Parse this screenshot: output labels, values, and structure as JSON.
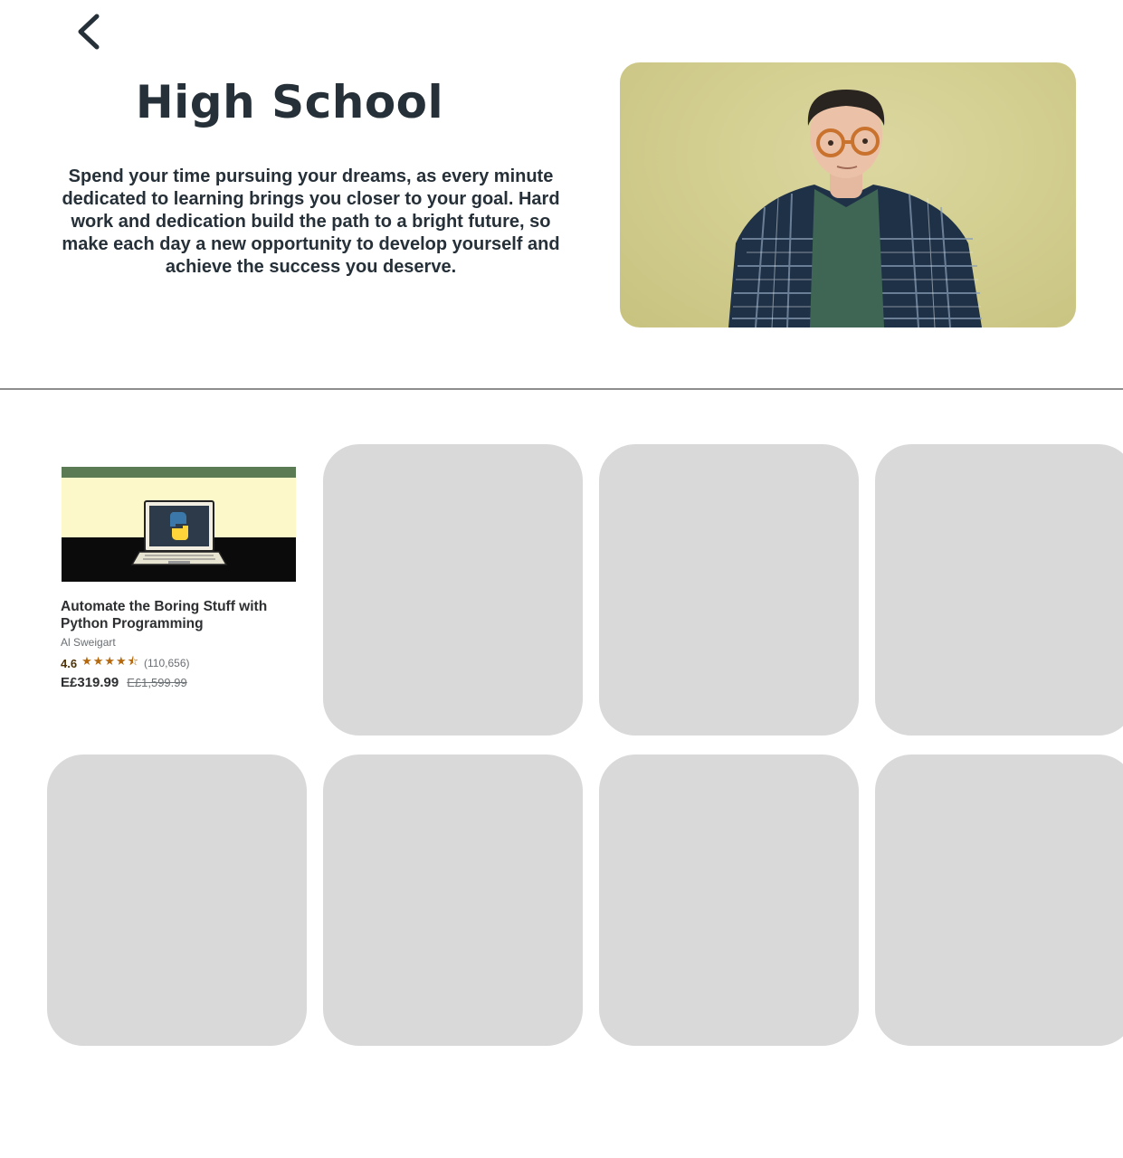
{
  "header": {
    "title": "High School",
    "description": "Spend your time pursuing your dreams, as every minute dedicated to learning brings you closer to your goal. Hard work and dedication build the path to a bright future, so make each day a new opportunity to develop yourself and achieve the success you deserve."
  },
  "icons": {
    "back": "chevron-left-icon",
    "python_logo": "python-logo-icon"
  },
  "colors": {
    "text": "#263038",
    "placeholder_tile": "#d9d9d9",
    "hero_bg": "#d3cf91",
    "rating_star": "#b4690e"
  },
  "course": {
    "title": "Automate the Boring Stuff with Python Programming",
    "author": "Al Sweigart",
    "rating": "4.6",
    "stars": 4.5,
    "stars_display": "★★★★⯪",
    "reviews": "(110,656)",
    "price": "E£319.99",
    "original_price": "E£1,599.99"
  }
}
